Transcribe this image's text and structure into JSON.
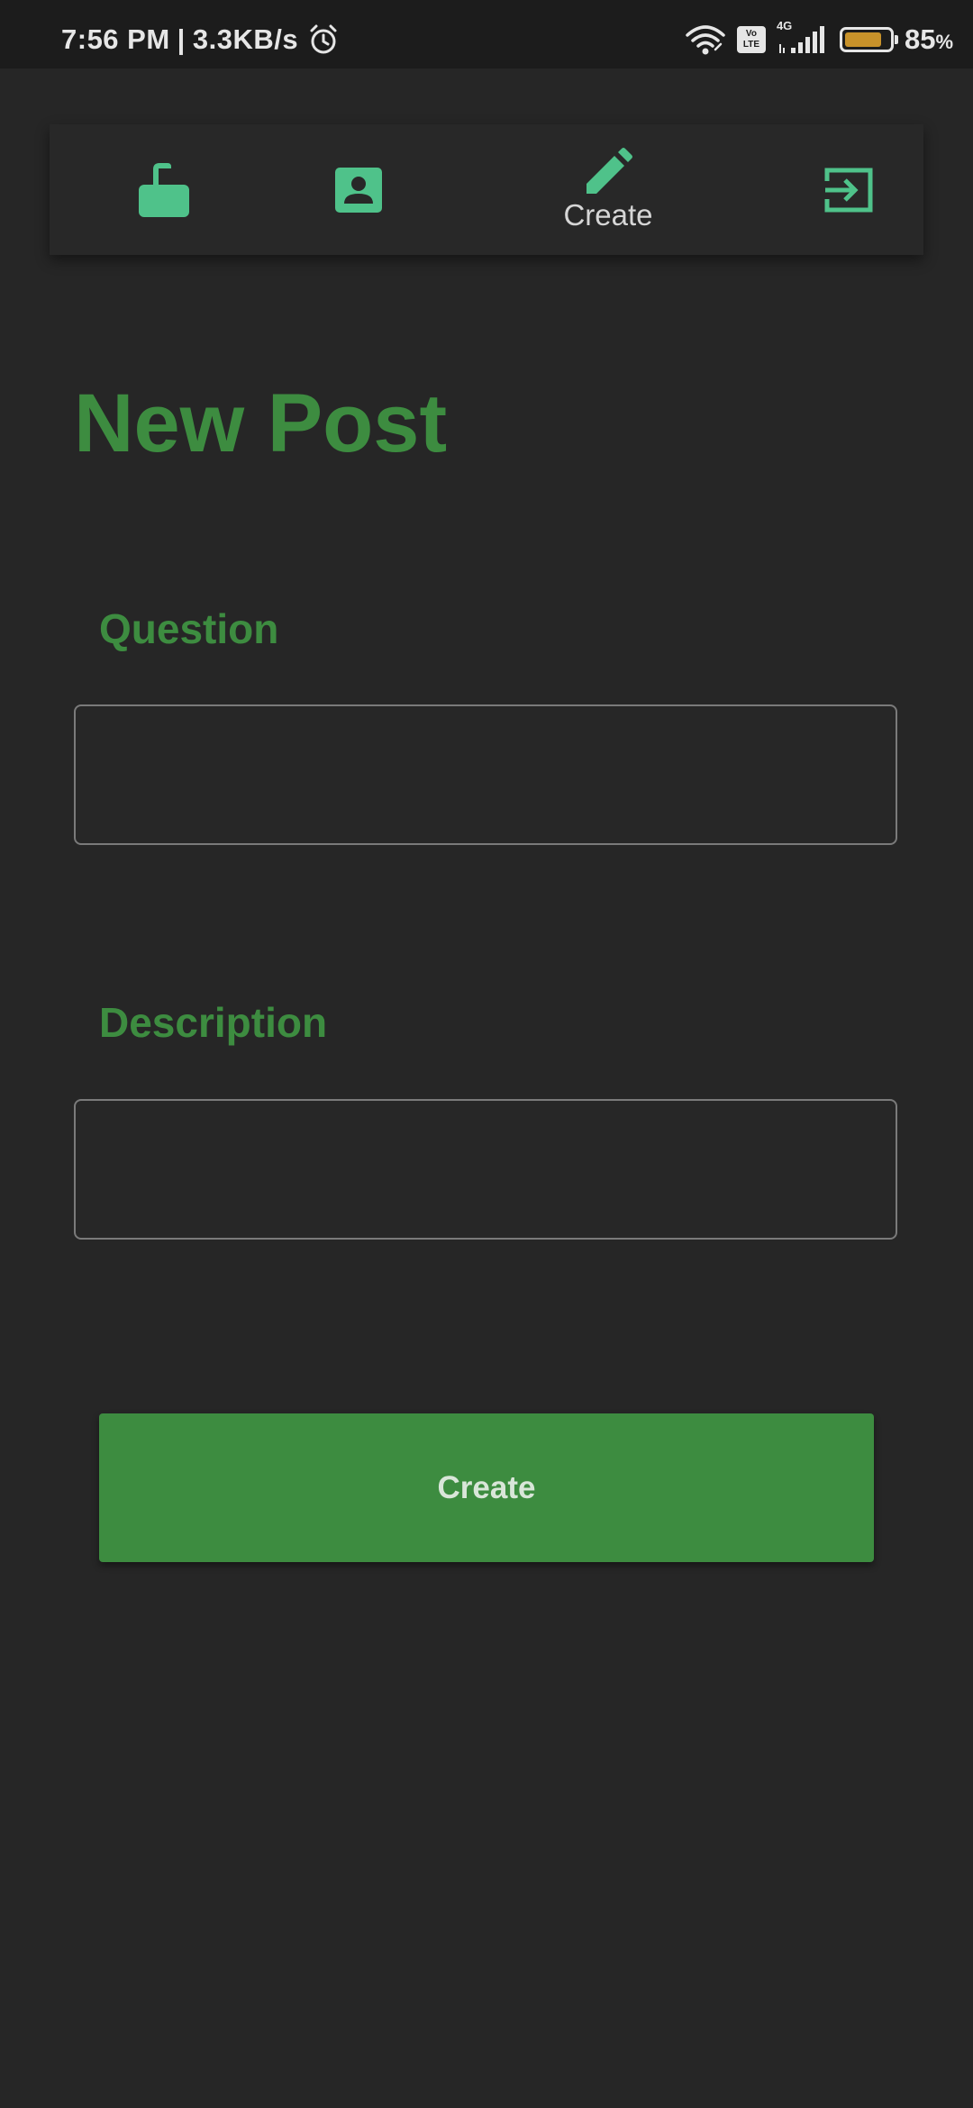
{
  "status_bar": {
    "time": "7:56 PM",
    "separator": "|",
    "net_speed": "3.3KB/s",
    "volte_top": "Vo",
    "volte_bottom": "LTE",
    "network_type": "4G",
    "battery_percent": "85",
    "battery_unit": "%",
    "battery_level": 0.85,
    "icons": [
      "alarm-icon",
      "wifi-icon",
      "volte-icon",
      "signal-icon",
      "battery-icon"
    ]
  },
  "nav": {
    "items": [
      {
        "icon": "lock-open-icon",
        "label": ""
      },
      {
        "icon": "contact-card-icon",
        "label": ""
      },
      {
        "icon": "pencil-icon",
        "label": "Create"
      },
      {
        "icon": "login-icon",
        "label": ""
      }
    ],
    "accent_color": "#4fc28a"
  },
  "page": {
    "title": "New Post"
  },
  "form": {
    "question_label": "Question",
    "question_value": "",
    "description_label": "Description",
    "description_value": "",
    "submit_label": "Create"
  },
  "colors": {
    "background": "#262626",
    "primary": "#3d8c40",
    "nav_icon": "#4fc28a",
    "field_border": "#7a7a7a"
  }
}
